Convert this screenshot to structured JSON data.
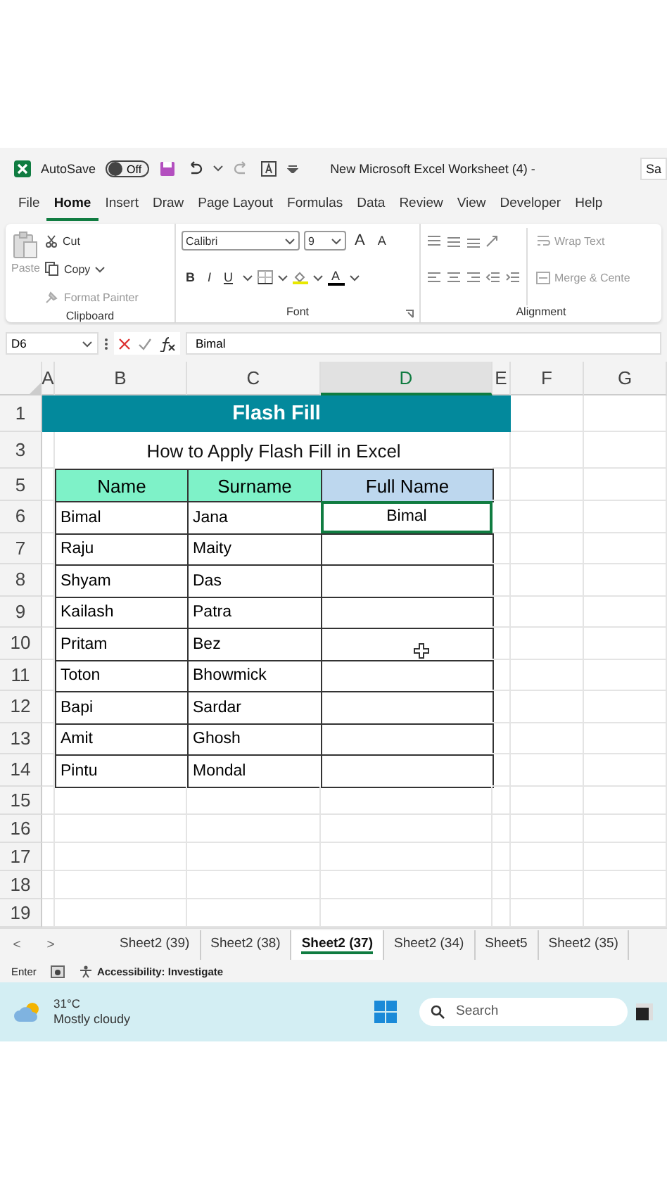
{
  "title_bar": {
    "autosave_label": "AutoSave",
    "autosave": {
      "label": "Off",
      "on": false
    },
    "title": "New Microsoft Excel Worksheet (4) -",
    "search": "Sa"
  },
  "menu_tabs": [
    {
      "label": "File",
      "selected": false
    },
    {
      "label": "Home",
      "selected": true
    },
    {
      "label": "Insert",
      "selected": false
    },
    {
      "label": "Draw",
      "selected": false
    },
    {
      "label": "Page Layout",
      "selected": false
    },
    {
      "label": "Formulas",
      "selected": false
    },
    {
      "label": "Data",
      "selected": false
    },
    {
      "label": "Review",
      "selected": false
    },
    {
      "label": "View",
      "selected": false
    },
    {
      "label": "Developer",
      "selected": false
    },
    {
      "label": "Help",
      "selected": false
    }
  ],
  "ribbon": {
    "clipboard": {
      "paste": "Paste",
      "cut": "Cut",
      "copy": "Copy",
      "format_painter": "Format Painter",
      "label": "Clipboard"
    },
    "font": {
      "font_name": "Calibri",
      "font_size": "9",
      "size_buttons": [
        "A",
        "A"
      ],
      "style_buttons": [
        "B",
        "I",
        "U"
      ],
      "color_button": "A",
      "label": "Font"
    },
    "alignment": {
      "wrap_text": "Wrap Text",
      "merge": "Merge & Cente",
      "label": "Alignment"
    }
  },
  "formula_bar": {
    "name_box": "D6",
    "value": "Bimal"
  },
  "columns": [
    {
      "label": "A",
      "selected": false
    },
    {
      "label": "B",
      "selected": false
    },
    {
      "label": "C",
      "selected": false
    },
    {
      "label": "D",
      "selected": true
    },
    {
      "label": "E",
      "selected": false
    },
    {
      "label": "F",
      "selected": false
    },
    {
      "label": "G",
      "selected": false
    }
  ],
  "sheet": {
    "banner": "Flash Fill",
    "subtitle": "How to Apply Flash Fill in Excel",
    "headers": [
      {
        "label": "Name",
        "color": "#7ef2c8"
      },
      {
        "label": "Surname",
        "color": "#7ef2c8"
      },
      {
        "label": "Full Name",
        "color": "#bdd7ee"
      }
    ],
    "rows": [
      {
        "number": "6",
        "name": "Bimal",
        "surname": "Jana",
        "full_name": "Bimal",
        "selected": true
      },
      {
        "number": "7",
        "name": "Raju",
        "surname": "Maity",
        "selected": false
      },
      {
        "number": "8",
        "name": "Shyam",
        "surname": "Das",
        "selected": false
      },
      {
        "number": "9",
        "name": "Kailash",
        "surname": "Patra",
        "selected": false
      },
      {
        "number": "10",
        "name": "Pritam",
        "surname": "Bez",
        "selected": false
      },
      {
        "number": "11",
        "name": "Toton",
        "surname": "Bhowmick",
        "selected": false
      },
      {
        "number": "12",
        "name": "Bapi",
        "surname": "Sardar",
        "selected": false
      },
      {
        "number": "13",
        "name": "Amit",
        "surname": "Ghosh",
        "selected": false
      },
      {
        "number": "14",
        "name": "Pintu",
        "surname": "Mondal",
        "selected": false
      }
    ],
    "title_row_numbers": [
      "1",
      "3",
      "5"
    ],
    "empty_row_numbers": [
      "15",
      "16",
      "17",
      "18",
      "19"
    ]
  },
  "sheet_tabs": {
    "prev": "<",
    "next": ">",
    "tabs": [
      {
        "label": "Sheet2 (39)",
        "selected": false
      },
      {
        "label": "Sheet2 (38)",
        "selected": false
      },
      {
        "label": "Sheet2 (37)",
        "selected": true
      },
      {
        "label": "Sheet2 (34)",
        "selected": false
      },
      {
        "label": "Sheet5",
        "selected": false
      },
      {
        "label": "Sheet2 (35)",
        "selected": false
      }
    ]
  },
  "status_bar": {
    "mode": "Enter",
    "accessibility": "Accessibility: Investigate"
  },
  "taskbar": {
    "temperature": "31°C",
    "weather": "Mostly cloudy",
    "search_placeholder": "Search"
  }
}
